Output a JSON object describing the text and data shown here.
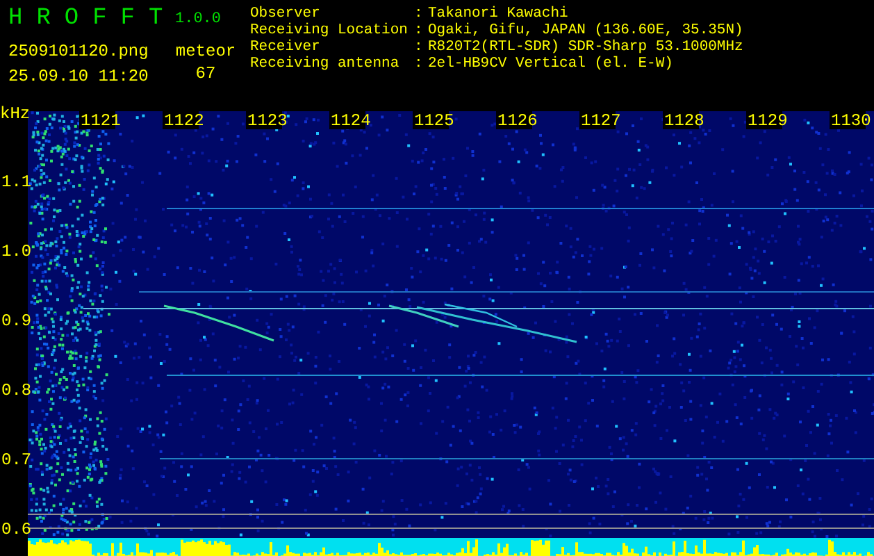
{
  "app": {
    "name": "HROFFT",
    "version": "1.0.0"
  },
  "file": {
    "name": "2509101120.png",
    "timestamp": "25.09.10 11:20"
  },
  "meteor": {
    "label": "meteor",
    "count": "67"
  },
  "station": [
    {
      "label": "Observer",
      "separator": ":",
      "value": "Takanori Kawachi"
    },
    {
      "label": "Receiving Location",
      "separator": ":",
      "value": "Ogaki, Gifu, JAPAN (136.60E, 35.35N)"
    },
    {
      "label": "Receiver",
      "separator": ":",
      "value": "R820T2(RTL-SDR) SDR-Sharp 53.1000MHz"
    },
    {
      "label": "Receiving antenna",
      "separator": ":",
      "value": "2el-HB9CV Vertical (el. E-W)"
    }
  ],
  "spectrogram": {
    "y_unit": "kHz",
    "y_labels": [
      "1.1",
      "1.0",
      "0.9",
      "0.8",
      "0.7",
      "0.6"
    ],
    "x_labels": [
      "1121",
      "1122",
      "1123",
      "1124",
      "1125",
      "1126",
      "1127",
      "1128",
      "1129",
      "1130"
    ]
  }
}
